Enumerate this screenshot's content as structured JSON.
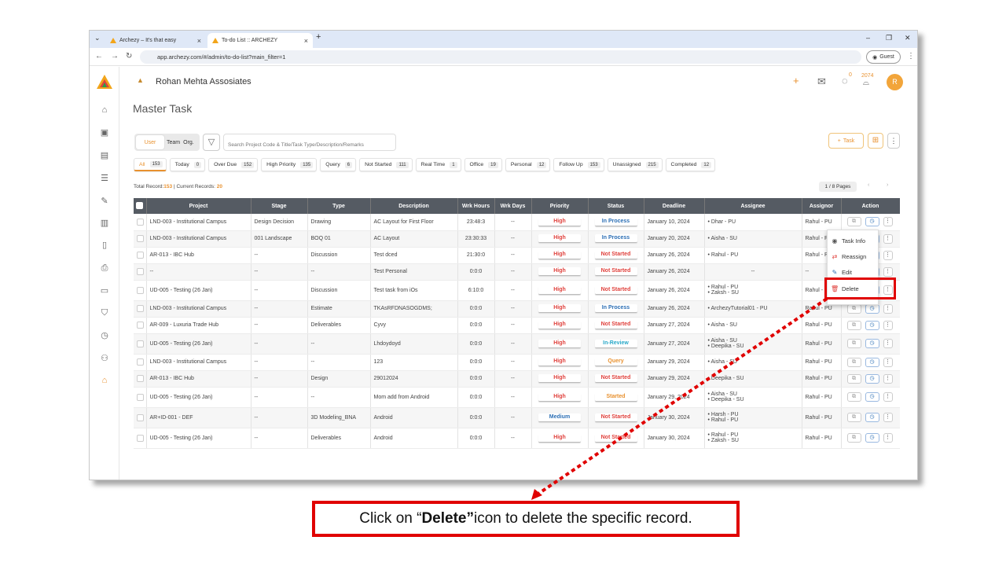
{
  "browser": {
    "tabs": [
      {
        "title": "Archezy – It's that easy",
        "active": false
      },
      {
        "title": "To-do List :: ARCHEZY",
        "active": true
      }
    ],
    "url": "app.archezy.com/#/admin/to-do-list?main_filter=1",
    "guest_label": "Guest"
  },
  "header": {
    "org_name": "Rohan Mehta Assosiates",
    "notification_count": "0",
    "points": "2074",
    "avatar_initial": "R"
  },
  "page": {
    "title": "Master Task",
    "segments": [
      "User",
      "Team",
      "Org."
    ],
    "search_placeholder": "Search Project Code & Title/Task Type/Description/Remarks",
    "add_task_label": "Task"
  },
  "filters": [
    {
      "label": "All",
      "count": "153",
      "active": true
    },
    {
      "label": "Today",
      "count": "0"
    },
    {
      "label": "Over Due",
      "count": "152"
    },
    {
      "label": "High Priority",
      "count": "135"
    },
    {
      "label": "Query",
      "count": "6"
    },
    {
      "label": "Not Started",
      "count": "111"
    },
    {
      "label": "Real Time",
      "count": "1"
    },
    {
      "label": "Office",
      "count": "19"
    },
    {
      "label": "Personal",
      "count": "12"
    },
    {
      "label": "Follow Up",
      "count": "153"
    },
    {
      "label": "Unassigned",
      "count": "215"
    },
    {
      "label": "Completed",
      "count": "12"
    }
  ],
  "totals": {
    "total_label": "Total Record:",
    "total_value": "153",
    "current_label": " | Current Records: ",
    "current_value": "20"
  },
  "pager": {
    "label": "1 / 8 Pages",
    "prev": "‹",
    "next": "›"
  },
  "table": {
    "columns": [
      "Project",
      "Stage",
      "Type",
      "Description",
      "Wrk Hours",
      "Wrk Days",
      "Priority",
      "Status",
      "Deadline",
      "Assignee",
      "Assignor",
      "Action"
    ],
    "rows": [
      {
        "project": "LND-003 - Institutional Campus",
        "stage": "Design Decision",
        "type": "Drawing",
        "desc": "AC Layout for First Floor",
        "hours": "23:48:3",
        "days": "--",
        "priority": "High",
        "status": "In Process",
        "deadline": "January 10, 2024",
        "assignees": [
          "Dhar - PU"
        ],
        "assignor": "Rahul - PU"
      },
      {
        "project": "LND-003 - Institutional Campus",
        "stage": "001 Landscape",
        "type": "BOQ 01",
        "desc": "AC Layout",
        "hours": "23:30:33",
        "days": "--",
        "priority": "High",
        "status": "In Process",
        "deadline": "January 20, 2024",
        "assignees": [
          "Aisha - SU"
        ],
        "assignor": "Rahul - PU"
      },
      {
        "project": "AR-013 - IBC Hub",
        "stage": "--",
        "type": "Discussion",
        "desc": "Test dced",
        "hours": "21:30:0",
        "days": "--",
        "priority": "High",
        "status": "Not Started",
        "deadline": "January 26, 2024",
        "assignees": [
          "Rahul - PU"
        ],
        "assignor": "Rahul - PU"
      },
      {
        "project": "--",
        "stage": "--",
        "type": "--",
        "desc": "Test Personal",
        "hours": "0:0:0",
        "days": "--",
        "priority": "High",
        "status": "Not Started",
        "deadline": "January 26, 2024",
        "assignees": [],
        "assignee_text": "--",
        "assignor": "--"
      },
      {
        "project": "UD-005 - Testing (26 Jan)",
        "stage": "--",
        "type": "Discussion",
        "desc": "Test task from iOs",
        "hours": "6:10:0",
        "days": "--",
        "priority": "High",
        "status": "Not Started",
        "deadline": "January 26, 2024",
        "assignees": [
          "Rahul - PU",
          "Zaksh - SU"
        ],
        "assignor": "Rahul - PU"
      },
      {
        "project": "LND-003 - Institutional Campus",
        "stage": "--",
        "type": "Estimate",
        "desc": "TKAsRFDNASOGDMS;",
        "hours": "0:0:0",
        "days": "--",
        "priority": "High",
        "status": "In Process",
        "deadline": "January 26, 2024",
        "assignees": [
          "ArchezyTutorial01 - PU"
        ],
        "assignor": "Rahul - PU"
      },
      {
        "project": "AR-009 - Luxuria Trade Hub",
        "stage": "--",
        "type": "Deliverables",
        "desc": "Cyvy",
        "hours": "0:0:0",
        "days": "--",
        "priority": "High",
        "status": "Not Started",
        "deadline": "January 27, 2024",
        "assignees": [
          "Aisha - SU"
        ],
        "assignor": "Rahul - PU"
      },
      {
        "project": "UD-005 - Testing (26 Jan)",
        "stage": "--",
        "type": "--",
        "desc": "Lhdoydoyd",
        "hours": "0:0:0",
        "days": "--",
        "priority": "High",
        "status": "In-Review",
        "deadline": "January 27, 2024",
        "assignees": [
          "Aisha - SU",
          "Deepika - SU"
        ],
        "assignor": "Rahul - PU"
      },
      {
        "project": "LND-003 - Institutional Campus",
        "stage": "--",
        "type": "--",
        "desc": "123",
        "hours": "0:0:0",
        "days": "--",
        "priority": "High",
        "status": "Query",
        "deadline": "January 29, 2024",
        "assignees": [
          "Aisha - SU"
        ],
        "assignor": "Rahul - PU"
      },
      {
        "project": "AR-013 - IBC Hub",
        "stage": "--",
        "type": "Design",
        "desc": "29012024",
        "hours": "0:0:0",
        "days": "--",
        "priority": "High",
        "status": "Not Started",
        "deadline": "January 29, 2024",
        "assignees": [
          "Deepika - SU"
        ],
        "assignor": "Rahul - PU"
      },
      {
        "project": "UD-005 - Testing (26 Jan)",
        "stage": "--",
        "type": "--",
        "desc": "Mom add from Android",
        "hours": "0:0:0",
        "days": "--",
        "priority": "High",
        "status": "Started",
        "deadline": "January 29, 2024",
        "assignees": [
          "Aisha - SU",
          "Deepika - SU"
        ],
        "assignor": "Rahul - PU"
      },
      {
        "project": "AR+ID-001 - DEF",
        "stage": "--",
        "type": "3D Modeling_BNA",
        "desc": "Android",
        "hours": "0:0:0",
        "days": "--",
        "priority": "Medium",
        "status": "Not Started",
        "deadline": "January 30, 2024",
        "assignees": [
          "Harsh - PU",
          "Rahul - PU"
        ],
        "assignor": "Rahul - PU"
      },
      {
        "project": "UD-005 - Testing (26 Jan)",
        "stage": "--",
        "type": "Deliverables",
        "desc": "Android",
        "hours": "0:0:0",
        "days": "--",
        "priority": "High",
        "status": "Not Started",
        "deadline": "January 30, 2024",
        "assignees": [
          "Rahul - PU",
          "Zaksh - SU"
        ],
        "assignor": "Rahul - PU"
      }
    ]
  },
  "action_menu": {
    "items": [
      "Task Info",
      "Reassign",
      "Edit",
      "Delete"
    ]
  },
  "callout": {
    "pre": "Click on “",
    "bold": "Delete”",
    "post": " icon to delete the specific record."
  },
  "colors": {
    "accent": "#e8912f",
    "high": "#e0413c",
    "blue": "#2c6fb5",
    "annotation": "#e00000"
  }
}
